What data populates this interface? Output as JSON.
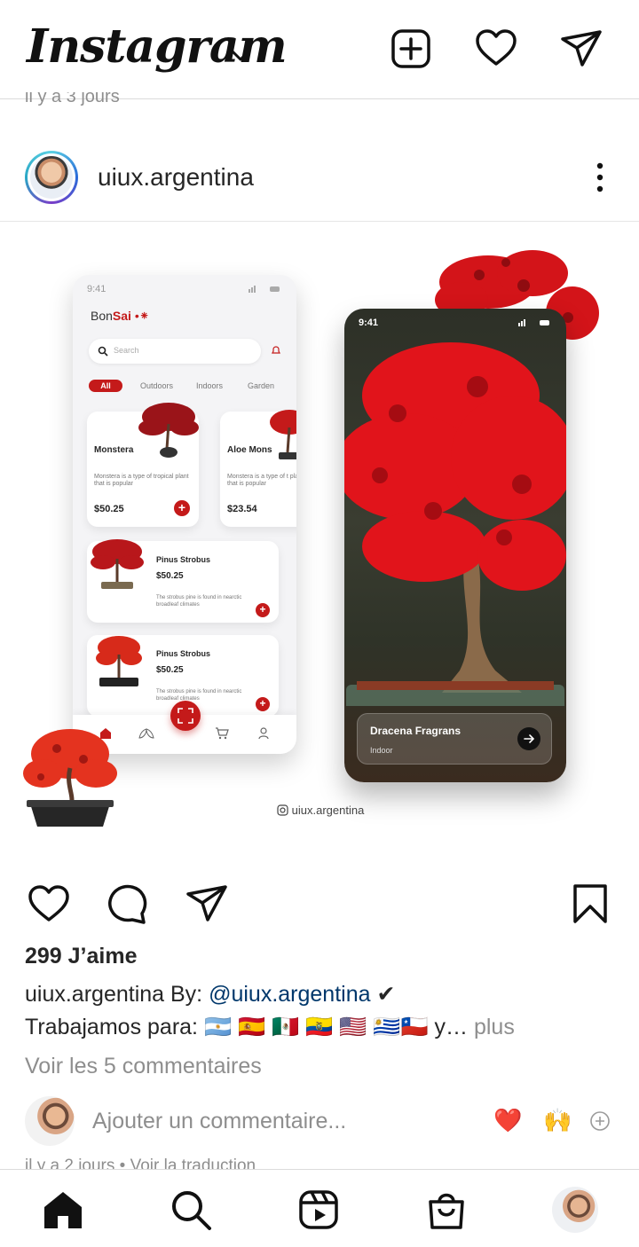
{
  "header": {
    "logo_text": "Instagram",
    "chevron_icon": "chevron-down-icon",
    "icons": [
      "new-post-icon",
      "heart-icon",
      "direct-message-icon"
    ]
  },
  "stale_post": {
    "time": "il y a 3 jours"
  },
  "post": {
    "username": "uiux.argentina",
    "menu_icon": "more-vertical-icon",
    "image": {
      "phone1": {
        "time": "9:41",
        "brand_prefix": "Bon",
        "brand_accent": "Sai",
        "search_placeholder": "Search",
        "chips": [
          "All",
          "Outdoors",
          "Indoors",
          "Garden"
        ],
        "cards": [
          {
            "title": "Monstera",
            "desc": "Monstera is a type of tropical plant that is popular",
            "price": "$50.25"
          },
          {
            "title": "Aloe Mons",
            "desc": "Monstera is a type of t plant that is popular",
            "price": "$23.54"
          }
        ],
        "list": [
          {
            "title": "Pinus Strobus",
            "price": "$50.25",
            "desc": "The strobus pine is found in nearctic broadleaf climates"
          },
          {
            "title": "Pinus Strobus",
            "price": "$50.25",
            "desc": "The strobus pine is found in nearctic broadleaf climates"
          }
        ],
        "plus": "+"
      },
      "phone2": {
        "time": "9:41",
        "title": "Dracena Fragrans",
        "subtitle": "Indoor"
      },
      "watermark": "uiux.argentina"
    },
    "likes": "299 J’aime",
    "caption_user": "uiux.argentina",
    "caption_by": " By: ",
    "caption_mention": "@uiux.argentina",
    "caption_check": " ✔",
    "caption_line2": "Trabajamos para: 🇦🇷 🇪🇸 🇲🇽 🇪🇨 🇺🇸 🇺🇾🇨🇱 y…",
    "caption_more": " plus",
    "view_comments": "Voir les 5 commentaires",
    "comment_placeholder": "Ajouter un commentaire...",
    "quick_emojis": [
      "❤️",
      "🙌"
    ],
    "time": "il y a 2 jours • Voir la traduction"
  },
  "bottom_nav": [
    "home-icon",
    "search-icon",
    "reels-icon",
    "shop-icon",
    "profile-avatar"
  ],
  "colors": {
    "accent_red": "#c41a1a",
    "link": "#00376b",
    "muted": "#8e8e8e",
    "text": "#262626"
  }
}
